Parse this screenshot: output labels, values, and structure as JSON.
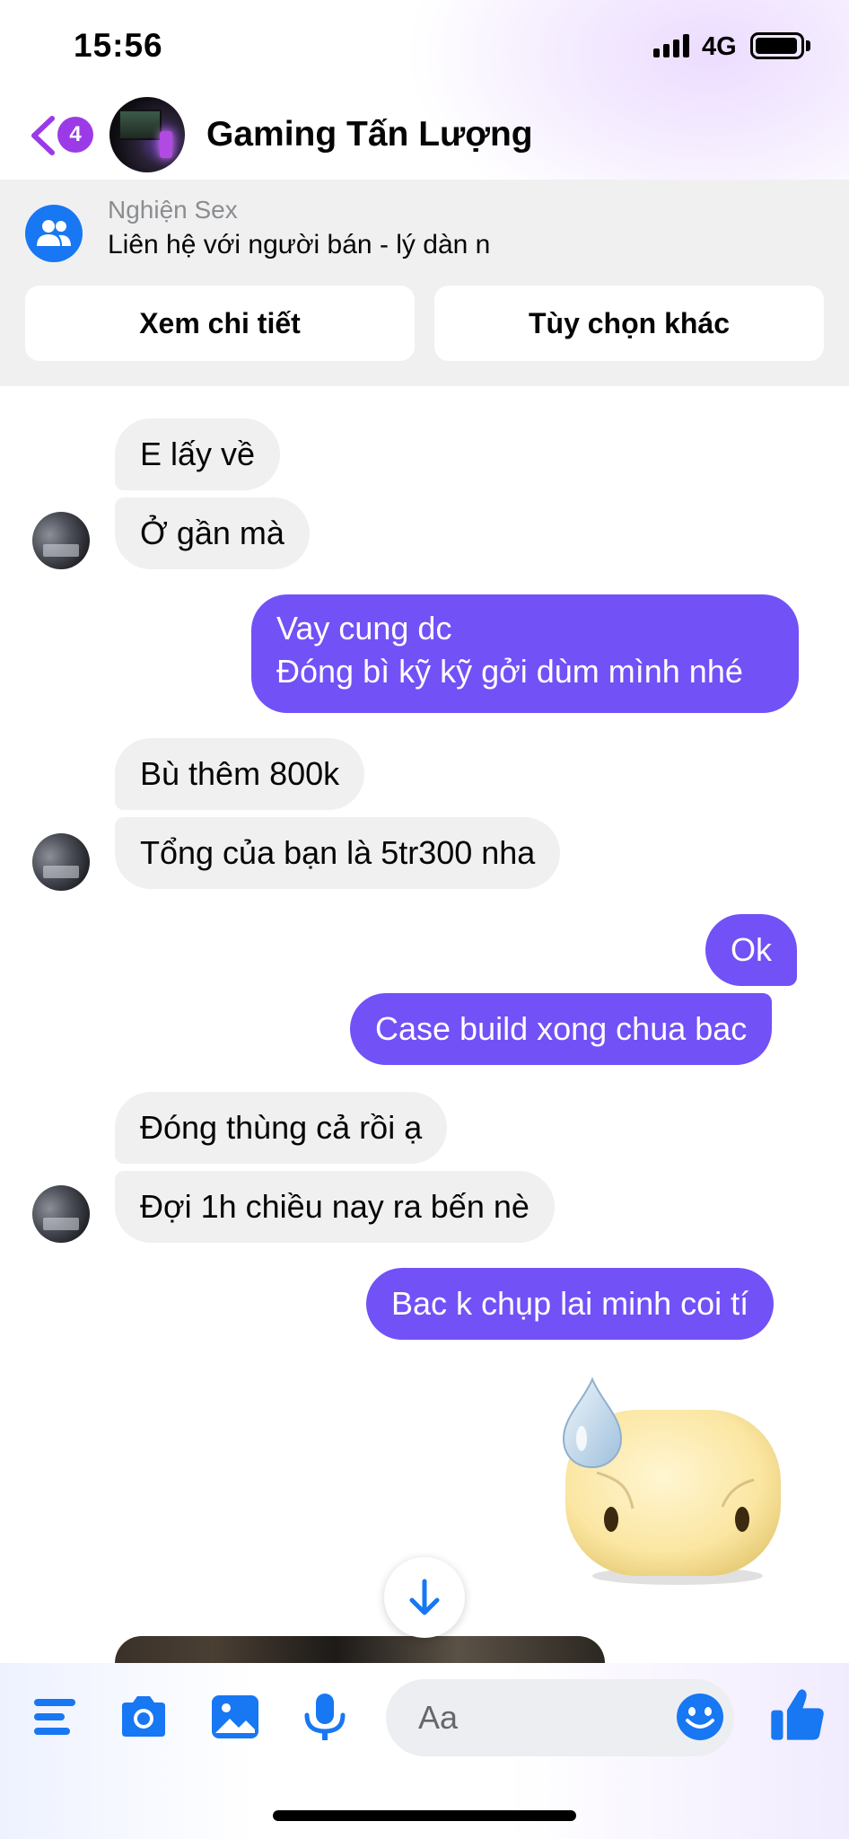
{
  "status_bar": {
    "time": "15:56",
    "network": "4G"
  },
  "header": {
    "badge_count": "4",
    "name": "Gaming Tấn Lượng"
  },
  "banner": {
    "group": "Nghiện Sex",
    "text": "Liên hệ với người bán - lý dàn n",
    "detail_button": "Xem chi tiết",
    "more_button": "Tùy chọn khác"
  },
  "messages": [
    {
      "from": "them",
      "text": "E lấy về"
    },
    {
      "from": "them",
      "text": "Ở gần mà"
    },
    {
      "from": "me",
      "lines": [
        "Vay cung dc",
        "Đóng bì kỹ kỹ gởi dùm mình nhé"
      ]
    },
    {
      "from": "them",
      "text": "Bù thêm 800k"
    },
    {
      "from": "them",
      "text": "Tổng của bạn là 5tr300 nha"
    },
    {
      "from": "me",
      "text": "Ok"
    },
    {
      "from": "me",
      "text": "Case build xong chua bac"
    },
    {
      "from": "them",
      "text": "Đóng thùng cả rồi ạ"
    },
    {
      "from": "them",
      "text": "Đợi 1h chiều nay ra bến nè"
    },
    {
      "from": "me",
      "text": "Bac k chụp lai minh coi tí"
    }
  ],
  "sticker": {
    "icon": "sweat-face-sticker"
  },
  "composer": {
    "placeholder": "Aa",
    "icons": [
      "menu-icon",
      "camera-icon",
      "photo-icon",
      "microphone-icon",
      "emoji-icon",
      "thumbs-up-icon"
    ]
  },
  "colors": {
    "outgoing_bubble": "#7251f7",
    "incoming_bubble": "#f0f0f0",
    "accent_blue": "#1877f2",
    "badge": "#9b3be8"
  }
}
